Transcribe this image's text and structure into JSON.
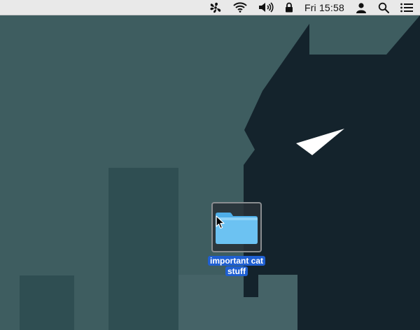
{
  "menubar": {
    "clock": "Fri 15:58",
    "status_icons": [
      "fan-icon",
      "wifi-icon",
      "volume-icon",
      "lock-icon",
      "user-icon",
      "spotlight-search-icon",
      "notification-center-icon"
    ]
  },
  "desktop": {
    "folder": {
      "icon": "folder-icon",
      "label_line1": "important cat",
      "label_line2": "stuff",
      "selected": true
    }
  },
  "colors": {
    "menubar_bg": "#e9e9e9",
    "wallpaper_teal": "#3e5d60",
    "wallpaper_dark": "#14232c",
    "selection_blue": "#1f5fd1",
    "folder_blue": "#6cc2f2"
  }
}
